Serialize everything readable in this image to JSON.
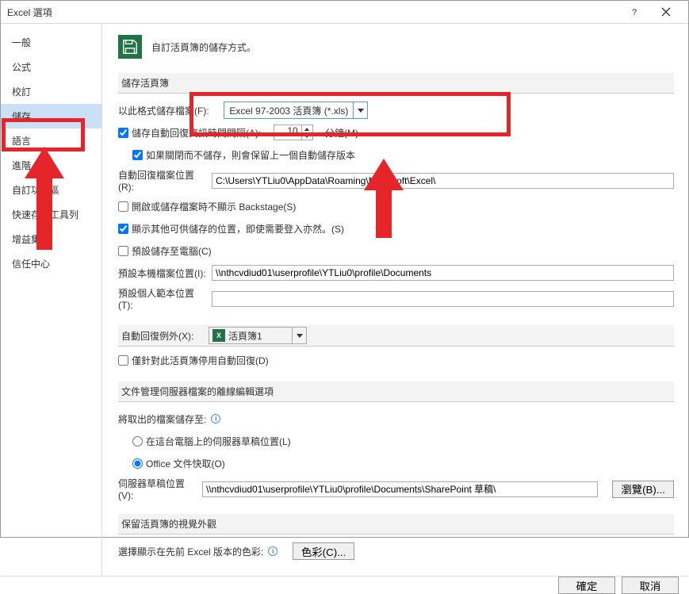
{
  "title": "Excel 選項",
  "sidebar": {
    "items": [
      {
        "label": "一般"
      },
      {
        "label": "公式"
      },
      {
        "label": "校訂"
      },
      {
        "label": "儲存",
        "active": true
      },
      {
        "label": "語言"
      },
      {
        "label": "進階"
      },
      {
        "label": "自訂功能區"
      },
      {
        "label": "快速存取工具列"
      },
      {
        "label": "增益集"
      },
      {
        "label": "信任中心"
      }
    ]
  },
  "header": {
    "desc": "自訂活頁簿的儲存方式。"
  },
  "section_save": {
    "title": "儲存活頁簿",
    "format_label": "以此格式儲存檔案(F):",
    "format_value": "Excel 97-2003 活頁簿 (*.xls)",
    "autorecover_label": "儲存自動回復資訊時間間隔(A):",
    "autorecover_value": "10",
    "autorecover_unit": "分鐘(M)",
    "keep_last_label": "如果關閉而不儲存，則會保留上一個自動儲存版本",
    "recover_loc_label": "自動回復檔案位置(R):",
    "recover_loc_value": "C:\\Users\\YTLiu0\\AppData\\Roaming\\Microsoft\\Excel\\",
    "no_backstage_label": "開啟或儲存檔案時不顯示 Backstage(S)",
    "show_extra_label": "顯示其他可供儲存的位置，即使需要登入亦然。(S)",
    "save_to_pc_label": "預設儲存至電腦(C)",
    "default_loc_label": "預設本機檔案位置(I):",
    "default_loc_value": "\\\\nthcvdiud01\\userprofile\\YTLiu0\\profile\\Documents",
    "template_loc_label": "預設個人範本位置(T):",
    "template_loc_value": ""
  },
  "section_except": {
    "label": "自動回復例外(X):",
    "workbook": "活頁簿1",
    "disable_label": "僅針對此活頁簿停用自動回復(D)"
  },
  "section_offline": {
    "title": "文件管理伺服器檔案的離線編輯選項",
    "save_checkout_label": "將取出的檔案儲存至:",
    "radio1": "在這台電腦上的伺服器草稿位置(L)",
    "radio2": "Office 文件快取(O)",
    "draft_loc_label": "伺服器草稿位置(V):",
    "draft_loc_value": "\\\\nthcvdiud01\\userprofile\\YTLiu0\\profile\\Documents\\SharePoint 草稿\\",
    "browse": "瀏覽(B)..."
  },
  "section_visual": {
    "title": "保留活頁簿的視覺外觀",
    "color_label": "選擇顯示在先前 Excel 版本的色彩:",
    "color_btn": "色彩(C)..."
  },
  "footer": {
    "ok": "確定",
    "cancel": "取消"
  }
}
